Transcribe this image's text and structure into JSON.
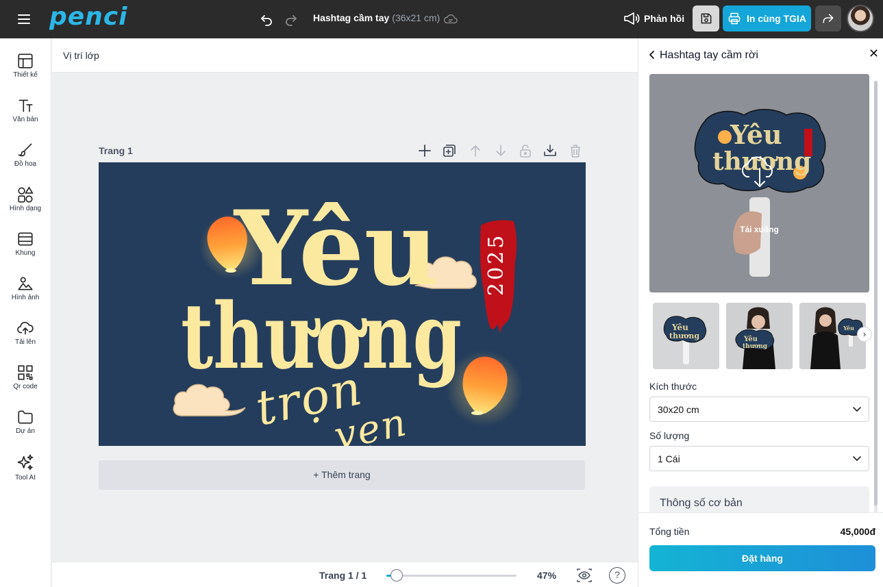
{
  "app": {
    "logo": "penci"
  },
  "header": {
    "doc_title": "Hashtag cầm tay",
    "doc_size": "(36x21 cm)",
    "feedback_label": "Phản hồi",
    "print_label": "In cùng TGIA"
  },
  "sidebar": {
    "items": [
      {
        "label": "Thiết kế",
        "icon": "layout-icon"
      },
      {
        "label": "Văn bản",
        "icon": "text-icon"
      },
      {
        "label": "Đồ hoạ",
        "icon": "brush-icon"
      },
      {
        "label": "Hình dạng",
        "icon": "shapes-icon"
      },
      {
        "label": "Khung",
        "icon": "frame-icon"
      },
      {
        "label": "Hình ảnh",
        "icon": "image-icon"
      },
      {
        "label": "Tải lên",
        "icon": "upload-cloud-icon"
      },
      {
        "label": "Qr code",
        "icon": "qr-code-icon"
      },
      {
        "label": "Dự án",
        "icon": "folder-icon"
      },
      {
        "label": "Tool AI",
        "icon": "sparkles-icon"
      }
    ]
  },
  "layer_bar": {
    "label": "Vị trí lớp"
  },
  "canvas": {
    "page_label": "Trang 1",
    "add_page_label": "+ Thêm trang",
    "design": {
      "line1": "Yêu",
      "line2": "thương",
      "line3a": "trọn",
      "line3b": "vẹn",
      "year": "2025",
      "background": "#243d5c",
      "text_color": "#fbe9a0",
      "accent": "#c0101a"
    }
  },
  "footer": {
    "page_count": "Trang 1 / 1",
    "zoom": "47%",
    "zoom_level": 0.08
  },
  "panel": {
    "title": "Hashtag tay cầm rời",
    "download_hint": "Tải xuống",
    "size_label": "Kích thước",
    "size_value": "30x20 cm",
    "qty_label": "Số lượng",
    "qty_value": "1 Cái",
    "specs_label": "Thông số cơ bản",
    "total_label": "Tổng tiền",
    "total_value": "45,000đ",
    "order_label": "Đặt hàng"
  }
}
